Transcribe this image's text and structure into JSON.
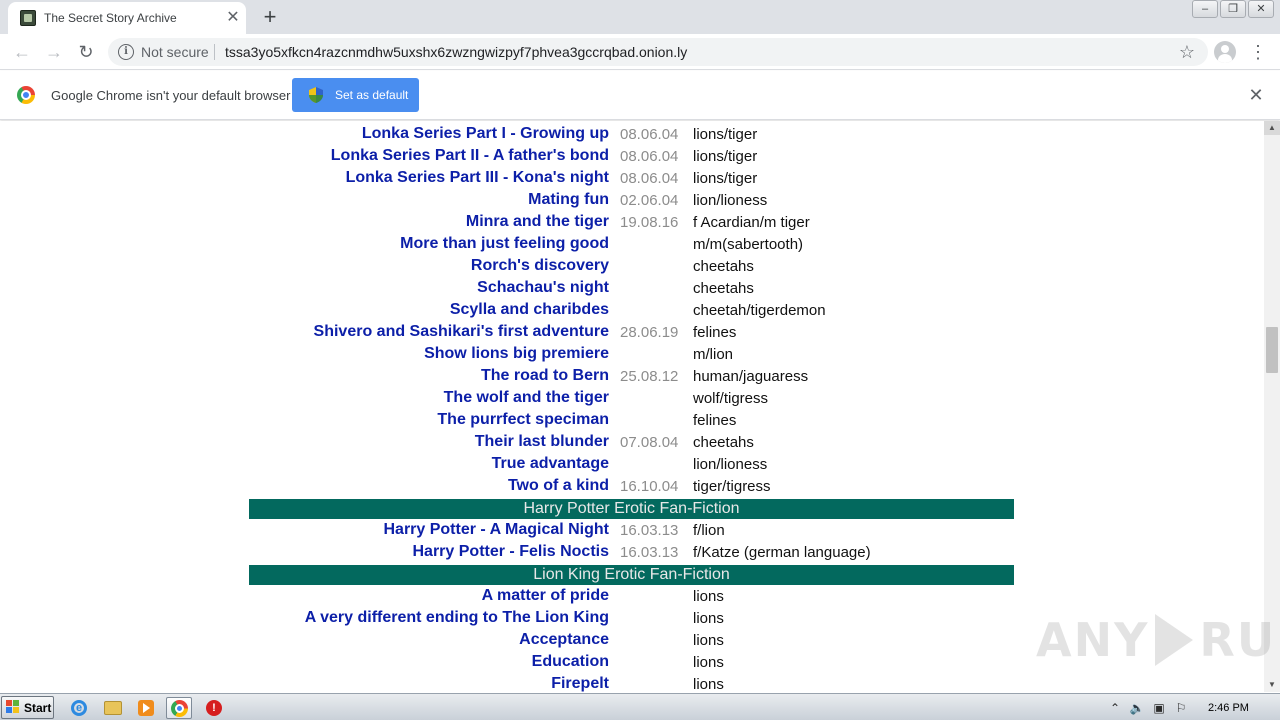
{
  "browser": {
    "tab_title": "The Secret Story Archive",
    "tab_close": "✕",
    "new_tab": "+",
    "security_label": "Not secure",
    "url": "tssa3yo5xfkcn4razcnmdhw5uxshx6zwzngwizpyf7phvea3gccrqbad.onion.ly"
  },
  "infobar": {
    "message": "Google Chrome isn't your default browser",
    "set_default_label": "Set as default",
    "close": "✕"
  },
  "stories_group1": [
    {
      "title": "Lonka Series Part I - Growing up",
      "date": "08.06.04",
      "tags": "lions/tiger"
    },
    {
      "title": "Lonka Series Part II - A father's bond",
      "date": "08.06.04",
      "tags": "lions/tiger"
    },
    {
      "title": "Lonka Series Part III - Kona's night",
      "date": "08.06.04",
      "tags": "lions/tiger"
    },
    {
      "title": "Mating fun",
      "date": "02.06.04",
      "tags": "lion/lioness"
    },
    {
      "title": "Minra and the tiger",
      "date": "19.08.16",
      "tags": "f Acardian/m tiger"
    },
    {
      "title": "More than just feeling good",
      "date": "",
      "tags": "m/m(sabertooth)"
    },
    {
      "title": "Rorch's discovery",
      "date": "",
      "tags": "cheetahs"
    },
    {
      "title": "Schachau's night",
      "date": "",
      "tags": "cheetahs"
    },
    {
      "title": "Scylla and charibdes",
      "date": "",
      "tags": "cheetah/tigerdemon"
    },
    {
      "title": "Shivero and Sashikari's first adventure",
      "date": "28.06.19",
      "tags": "felines"
    },
    {
      "title": "Show lions big premiere",
      "date": "",
      "tags": "m/lion"
    },
    {
      "title": "The road to Bern",
      "date": "25.08.12",
      "tags": "human/jaguaress"
    },
    {
      "title": "The wolf and the tiger",
      "date": "",
      "tags": "wolf/tigress"
    },
    {
      "title": "The purrfect speciman",
      "date": "",
      "tags": "felines"
    },
    {
      "title": "Their last blunder",
      "date": "07.08.04",
      "tags": "cheetahs"
    },
    {
      "title": "True advantage",
      "date": "",
      "tags": "lion/lioness"
    },
    {
      "title": "Two of a kind",
      "date": "16.10.04",
      "tags": "tiger/tigress"
    }
  ],
  "section_harry_potter": "Harry Potter Erotic Fan-Fiction",
  "stories_group2": [
    {
      "title": "Harry Potter - A Magical Night",
      "date": "16.03.13",
      "tags": "f/lion"
    },
    {
      "title": "Harry Potter - Felis Noctis",
      "date": "16.03.13",
      "tags": "f/Katze (german language)"
    }
  ],
  "section_lion_king": "Lion King Erotic Fan-Fiction",
  "stories_group3": [
    {
      "title": "A matter of pride",
      "date": "",
      "tags": "lions"
    },
    {
      "title": "A very different ending to The Lion King",
      "date": "",
      "tags": "lions"
    },
    {
      "title": "Acceptance",
      "date": "",
      "tags": "lions"
    },
    {
      "title": "Education",
      "date": "",
      "tags": "lions"
    },
    {
      "title": "Firepelt",
      "date": "",
      "tags": "lions"
    }
  ],
  "watermark": {
    "left": "ANY",
    "right": "RUN"
  },
  "taskbar": {
    "start_label": "Start",
    "clock": "2:46 PM"
  },
  "colors": {
    "link": "#0c1fa8",
    "date": "#8c8c8c",
    "section_bg": "#03695e",
    "button_blue": "#4a8ef0"
  },
  "icons": [
    "info-icon",
    "back-arrow-icon",
    "forward-arrow-icon",
    "reload-icon",
    "star-icon",
    "avatar-icon",
    "menu-dots-icon",
    "chrome-logo-icon",
    "shield-icon",
    "close-icon",
    "windows-flag-icon",
    "ie-icon",
    "folder-icon",
    "media-player-icon",
    "chrome-icon",
    "stop-icon"
  ]
}
